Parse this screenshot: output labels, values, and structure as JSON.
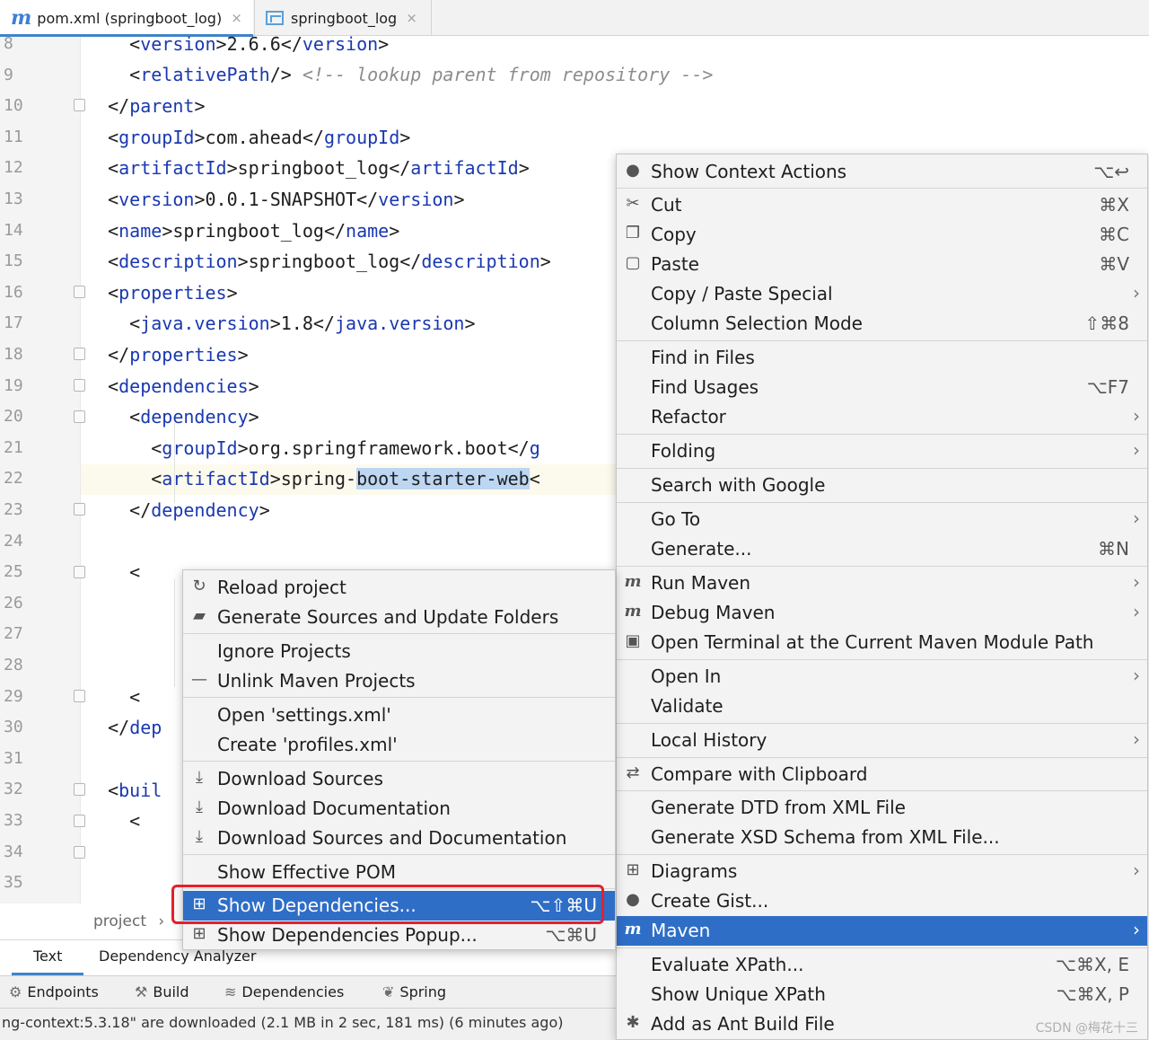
{
  "tabs": [
    {
      "icon": "maven-icon",
      "label": "pom.xml (springboot_log)",
      "close": "×"
    },
    {
      "icon": "diagram-icon",
      "label": "springboot_log",
      "close": "×"
    }
  ],
  "editor": {
    "line_numbers": [
      "8",
      "9",
      "10",
      "11",
      "12",
      "13",
      "14",
      "15",
      "16",
      "17",
      "18",
      "19",
      "20",
      "21",
      "22",
      "23",
      "24",
      "25",
      "26",
      "27",
      "28",
      "29",
      "30",
      "31",
      "32",
      "33",
      "34",
      "35"
    ],
    "lines": {
      "l8": {
        "open": "<",
        "tag": "version",
        "close": ">",
        "text": "2.6.6",
        "end_open": "</",
        "end_tag": "version",
        "end_close": ">"
      },
      "l9": {
        "open": "<",
        "tag": "relativePath",
        "close": "/>",
        "comment": "<!-- lookup parent from repository -->"
      },
      "l10": {
        "open": "</",
        "tag": "parent",
        "close": ">"
      },
      "l11": {
        "open": "<",
        "tag": "groupId",
        "close": ">",
        "text": "com.ahead",
        "end_open": "</",
        "end_tag": "groupId",
        "end_close": ">"
      },
      "l12": {
        "open": "<",
        "tag": "artifactId",
        "close": ">",
        "text": "springboot_log",
        "end_open": "</",
        "end_tag": "artifactId",
        "end_close": ">"
      },
      "l13": {
        "open": "<",
        "tag": "version",
        "close": ">",
        "text": "0.0.1-SNAPSHOT",
        "end_open": "</",
        "end_tag": "version",
        "end_close": ">"
      },
      "l14": {
        "open": "<",
        "tag": "name",
        "close": ">",
        "text": "springboot_log",
        "end_open": "</",
        "end_tag": "name",
        "end_close": ">"
      },
      "l15": {
        "open": "<",
        "tag": "description",
        "close": ">",
        "text": "springboot_log",
        "end_open": "</",
        "end_tag": "description",
        "end_close": ">"
      },
      "l16": {
        "open": "<",
        "tag": "properties",
        "close": ">"
      },
      "l17": {
        "open": "<",
        "tag": "java.version",
        "close": ">",
        "text": "1.8",
        "end_open": "</",
        "end_tag": "java.version",
        "end_close": ">"
      },
      "l18": {
        "open": "</",
        "tag": "properties",
        "close": ">"
      },
      "l19": {
        "open": "<",
        "tag": "dependencies",
        "close": ">"
      },
      "l20": {
        "open": "<",
        "tag": "dependency",
        "close": ">"
      },
      "l21": {
        "open": "<",
        "tag": "groupId",
        "close": ">",
        "text": "org.springframework.boot",
        "end_open": "</",
        "end_tag": "g"
      },
      "l22": {
        "open": "<",
        "tag": "artifactId",
        "close": ">",
        "text": "spring-",
        "selected": "boot-starter-web",
        "end_open": "<"
      },
      "l23": {
        "open": "</",
        "tag": "dependency",
        "close": ">"
      },
      "l30": {
        "open": "</",
        "tag": "dep"
      },
      "l32": {
        "open": "<",
        "tag": "buil"
      }
    },
    "partial_marks": {
      "l25": "<",
      "l29": "<",
      "l33": "<"
    }
  },
  "breadcrumb": {
    "label": "project",
    "sep": "›"
  },
  "bottom_tabs": [
    "Text",
    "Dependency Analyzer"
  ],
  "tool_tabs": [
    {
      "icon": "endpoints-icon",
      "glyph": "⚙",
      "label": "Endpoints"
    },
    {
      "icon": "hammer-icon",
      "glyph": "⚒",
      "label": "Build"
    },
    {
      "icon": "layers-icon",
      "glyph": "≋",
      "label": "Dependencies"
    },
    {
      "icon": "spring-leaf-icon",
      "glyph": "❦",
      "label": "Spring"
    }
  ],
  "status_text": "ng-context:5.3.18\" are downloaded (2.1 MB in 2 sec, 181 ms) (6 minutes ago)",
  "main_menu": {
    "items": [
      {
        "label": "Show Context Actions",
        "shortcut": "⌥↩",
        "icon": "bulb-icon",
        "glyph": "●"
      },
      {
        "label": "Cut",
        "shortcut": "⌘X",
        "icon": "scissors-icon",
        "glyph": "✂"
      },
      {
        "label": "Copy",
        "shortcut": "⌘C",
        "icon": "copy-icon",
        "glyph": "❐"
      },
      {
        "label": "Paste",
        "shortcut": "⌘V",
        "icon": "clipboard-icon",
        "glyph": "▢"
      },
      {
        "label": "Copy / Paste Special",
        "arrow": "›"
      },
      {
        "label": "Column Selection Mode",
        "shortcut": "⇧⌘8"
      },
      {
        "label": "Find in Files"
      },
      {
        "label": "Find Usages",
        "shortcut": "⌥F7"
      },
      {
        "label": "Refactor",
        "arrow": "›"
      },
      {
        "label": "Folding",
        "arrow": "›"
      },
      {
        "label": "Search with Google"
      },
      {
        "label": "Go To",
        "arrow": "›"
      },
      {
        "label": "Generate...",
        "shortcut": "⌘N"
      },
      {
        "label": "Run Maven",
        "arrow": "›",
        "icon": "run-maven-icon",
        "glyph": "m"
      },
      {
        "label": "Debug Maven",
        "arrow": "›",
        "icon": "debug-maven-icon",
        "glyph": "m"
      },
      {
        "label": "Open Terminal at the Current Maven Module Path",
        "icon": "terminal-maven-icon",
        "glyph": "▣"
      },
      {
        "label": "Open In",
        "arrow": "›"
      },
      {
        "label": "Validate"
      },
      {
        "label": "Local History",
        "arrow": "›"
      },
      {
        "label": "Compare with Clipboard",
        "icon": "compare-icon",
        "glyph": "⇄"
      },
      {
        "label": "Generate DTD from XML File"
      },
      {
        "label": "Generate XSD Schema from XML File..."
      },
      {
        "label": "Diagrams",
        "arrow": "›",
        "icon": "diagram-icon",
        "glyph": "⊞"
      },
      {
        "label": "Create Gist...",
        "icon": "github-icon",
        "glyph": "●"
      },
      {
        "label": "Maven",
        "arrow": "›",
        "icon": "maven-icon",
        "glyph": "m"
      },
      {
        "label": "Evaluate XPath...",
        "shortcut": "⌥⌘X, E"
      },
      {
        "label": "Show Unique XPath",
        "shortcut": "⌥⌘X, P"
      },
      {
        "label": "Add as Ant Build File",
        "icon": "ant-icon",
        "glyph": "✱"
      }
    ]
  },
  "maven_menu": {
    "items": [
      {
        "label": "Reload project",
        "icon": "reload-icon",
        "glyph": "↻"
      },
      {
        "label": "Generate Sources and Update Folders",
        "icon": "folder-reload-icon",
        "glyph": "▰"
      },
      {
        "label": "Ignore Projects"
      },
      {
        "label": "Unlink Maven Projects",
        "icon": "minus-icon",
        "glyph": "—"
      },
      {
        "label": "Open 'settings.xml'"
      },
      {
        "label": "Create 'profiles.xml'"
      },
      {
        "label": "Download Sources",
        "icon": "download-icon",
        "glyph": "⤓"
      },
      {
        "label": "Download Documentation",
        "icon": "download-icon",
        "glyph": "⤓"
      },
      {
        "label": "Download Sources and Documentation",
        "icon": "download-icon",
        "glyph": "⤓"
      },
      {
        "label": "Show Effective POM"
      },
      {
        "label": "Show Dependencies...",
        "shortcut": "⌥⇧⌘U",
        "icon": "diagram-icon",
        "glyph": "⊞"
      },
      {
        "label": "Show Dependencies Popup...",
        "shortcut": "⌥⌘U",
        "icon": "diagram-icon",
        "glyph": "⊞"
      }
    ]
  },
  "watermark": "CSDN @梅花十三",
  "colors": {
    "accent": "#2f6ec7",
    "highlight_box": "#e5202a",
    "xml_tag": "#1a38b0"
  }
}
